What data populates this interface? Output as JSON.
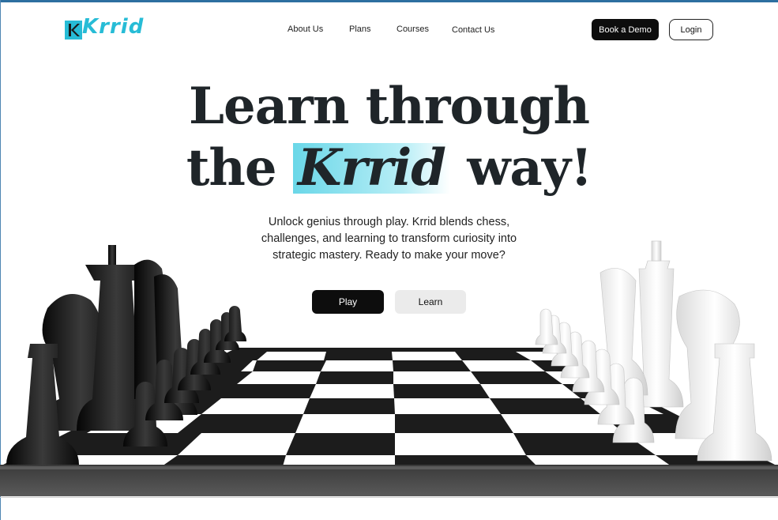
{
  "brand": {
    "name": "Krrid",
    "accent": "#27bcd6"
  },
  "nav": {
    "items": [
      "About Us",
      "Plans",
      "Courses",
      "Contact Us"
    ],
    "book_demo": "Book a Demo",
    "login": "Login"
  },
  "hero": {
    "title_line1": "Learn through",
    "title_prefix": "the",
    "title_highlight": "Krrid",
    "title_suffix": "way!",
    "subtitle": "Unlock genius through play. Krrid blends chess, challenges, and learning to transform curiosity into strategic mastery. Ready to make your move?",
    "play_label": "Play",
    "learn_label": "Learn"
  },
  "illustration": {
    "subject": "chessboard-with-black-and-white-pieces",
    "colors": {
      "dark_piece": "#161616",
      "light_piece": "#f2f2f2",
      "dark_square": "#2a2a2a",
      "light_square": "#ffffff"
    }
  }
}
